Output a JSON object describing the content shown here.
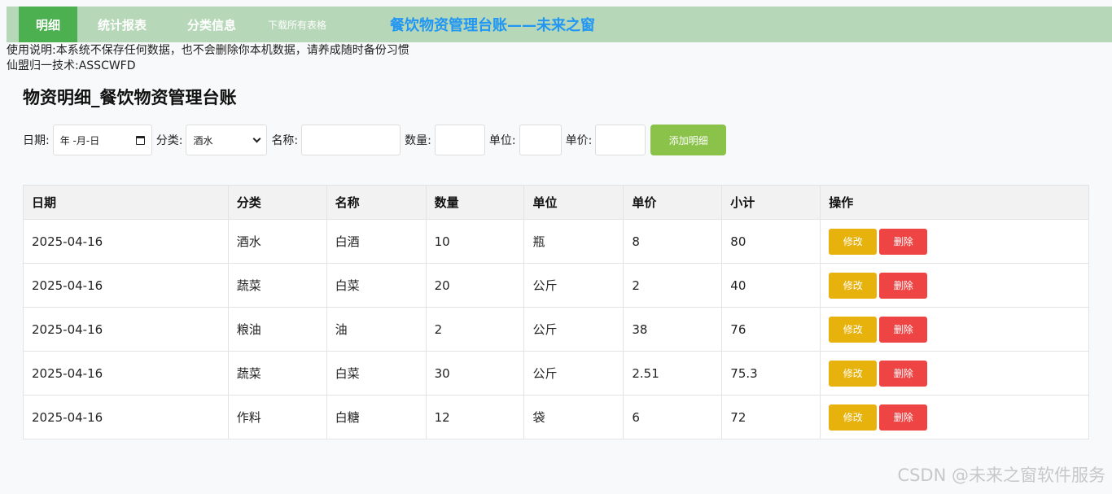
{
  "nav": {
    "tabs": [
      {
        "label": "明细"
      },
      {
        "label": "统计报表"
      },
      {
        "label": "分类信息"
      }
    ],
    "download_label": "下载所有表格",
    "app_title": "餐饮物资管理台账——未来之窗"
  },
  "notice": {
    "line1": "使用说明:本系统不保存任何数据，也不会删除你本机数据，请养成随时备份习惯",
    "line2": "仙盟归一技术:ASSCWFD"
  },
  "page_title": "物资明细_餐饮物资管理台账",
  "form": {
    "date_label": "日期:",
    "date_placeholder": "年 -月-日",
    "category_label": "分类:",
    "category_selected": "酒水",
    "name_label": "名称:",
    "qty_label": "数量:",
    "unit_label": "单位:",
    "price_label": "单价:",
    "add_label": "添加明细"
  },
  "table": {
    "headers": [
      "日期",
      "分类",
      "名称",
      "数量",
      "单位",
      "单价",
      "小计",
      "操作"
    ],
    "edit_label": "修改",
    "delete_label": "删除",
    "rows": [
      [
        "2025-04-16",
        "酒水",
        "白酒",
        "10",
        "瓶",
        "8",
        "80"
      ],
      [
        "2025-04-16",
        "蔬菜",
        "白菜",
        "20",
        "公斤",
        "2",
        "40"
      ],
      [
        "2025-04-16",
        "粮油",
        "油",
        "2",
        "公斤",
        "38",
        "76"
      ],
      [
        "2025-04-16",
        "蔬菜",
        "白菜",
        "30",
        "公斤",
        "2.51",
        "75.3"
      ],
      [
        "2025-04-16",
        "作料",
        "白糖",
        "12",
        "袋",
        "6",
        "72"
      ]
    ]
  },
  "watermark": "CSDN @未来之窗软件服务"
}
